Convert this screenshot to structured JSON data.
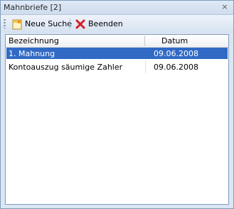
{
  "window": {
    "title": "Mahnbriefe [2]",
    "close_glyph": "×"
  },
  "toolbar": {
    "new_search_label": "Neue Suche",
    "new_search_icon": "new-search-icon",
    "exit_label": "Beenden",
    "exit_icon": "close-red-x-icon"
  },
  "table": {
    "columns": [
      "Bezeichnung",
      "Datum"
    ],
    "rows": [
      {
        "name": "1. Mahnung",
        "date": "09.06.2008",
        "selected": true
      },
      {
        "name": "Kontoauszug säumige Zahler",
        "date": "09.06.2008",
        "selected": false
      }
    ]
  },
  "colors": {
    "selection": "#316ac5",
    "border": "#7f9db9",
    "panel": "#dbe6f4",
    "exit_icon": "#d42020"
  }
}
